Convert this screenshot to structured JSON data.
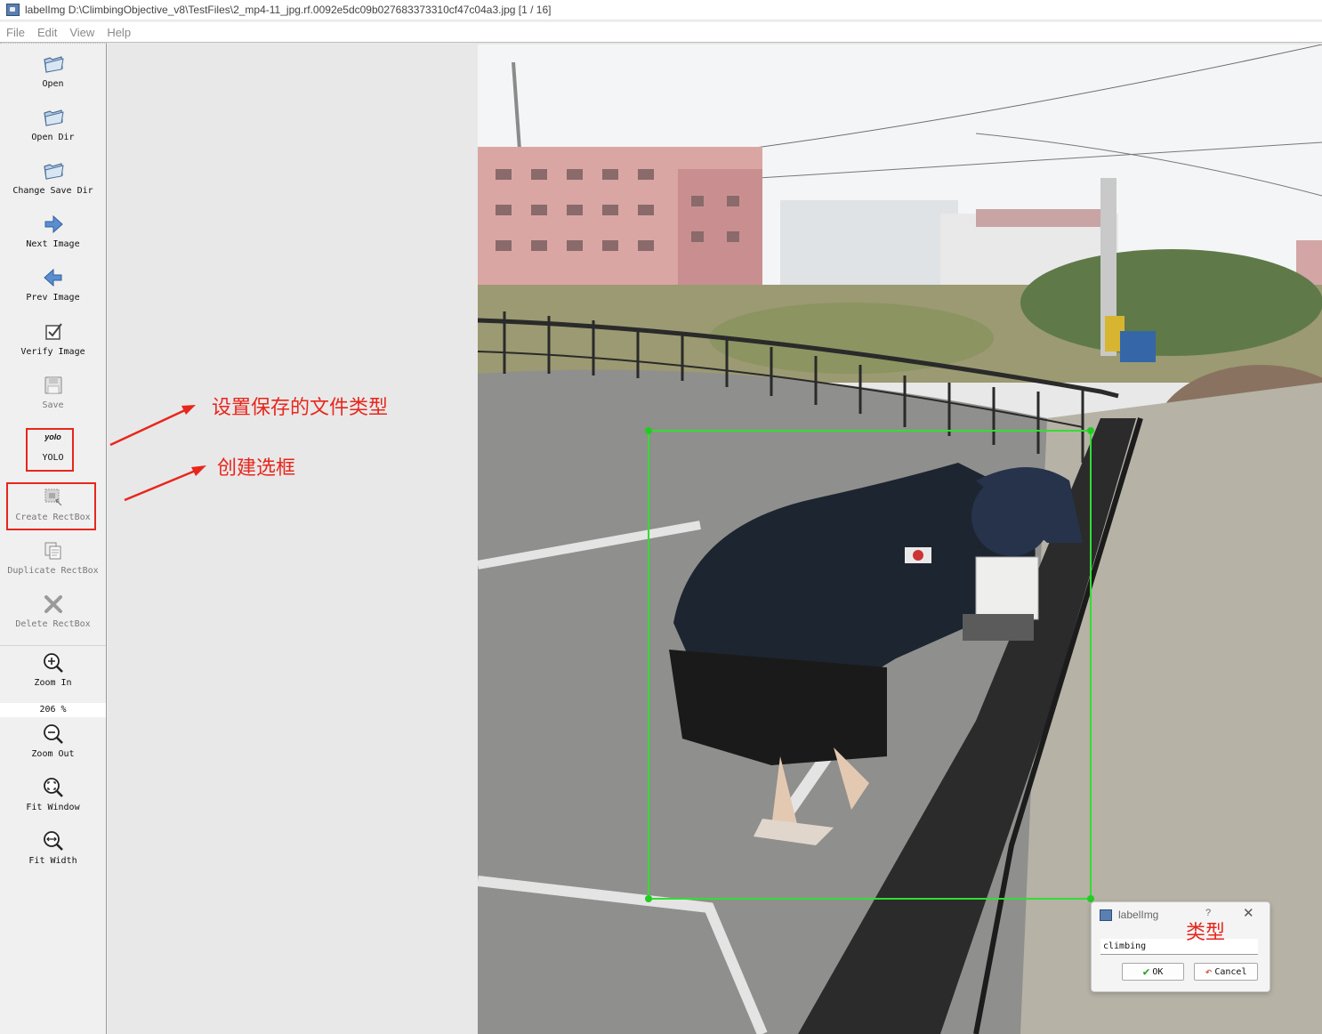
{
  "window": {
    "title": "labelImg D:\\ClimbingObjective_v8\\TestFiles\\2_mp4-11_jpg.rf.0092e5dc09b027683373310cf47c04a3.jpg [1 / 16]"
  },
  "menu": {
    "items": [
      "File",
      "Edit",
      "View",
      "Help"
    ]
  },
  "toolbar": {
    "open": "Open",
    "open_dir": "Open Dir",
    "change_save_dir": "Change Save Dir",
    "next_image": "Next Image",
    "prev_image": "Prev Image",
    "verify_image": "Verify Image",
    "save": "Save",
    "format_badge": "yolo",
    "format": "YOLO",
    "create_rectbox": "Create RectBox",
    "duplicate_rectbox": "Duplicate RectBox",
    "delete_rectbox": "Delete RectBox",
    "zoom_in": "Zoom In",
    "zoom_value": "206 %",
    "zoom_out": "Zoom Out",
    "fit_window": "Fit Window",
    "fit_width": "Fit Width"
  },
  "annotations": {
    "save_format_note": "设置保存的文件类型",
    "create_box_note": "创建选框",
    "class_note": "类型"
  },
  "label_dialog": {
    "title": "labelImg",
    "help": "?",
    "close": "✕",
    "value": "climbing",
    "ok": "OK",
    "cancel": "Cancel"
  },
  "colors": {
    "annotation_red": "#e8261c",
    "bbox_green": "#33dd33",
    "toolbar_bg": "#f0f0f0",
    "canvas_bg": "#e8e8e8"
  },
  "icons": {
    "open": "folder-icon",
    "open_dir": "folder-icon",
    "change_save_dir": "folder-icon",
    "next_image": "arrow-right-icon",
    "prev_image": "arrow-left-icon",
    "verify_image": "checkbox-icon",
    "save": "floppy-icon",
    "create_rectbox": "rectbox-icon",
    "duplicate_rectbox": "copy-icon",
    "delete_rectbox": "cross-icon",
    "zoom_in": "zoom-in-icon",
    "zoom_out": "zoom-out-icon",
    "fit_window": "fit-window-icon",
    "fit_width": "fit-width-icon"
  }
}
